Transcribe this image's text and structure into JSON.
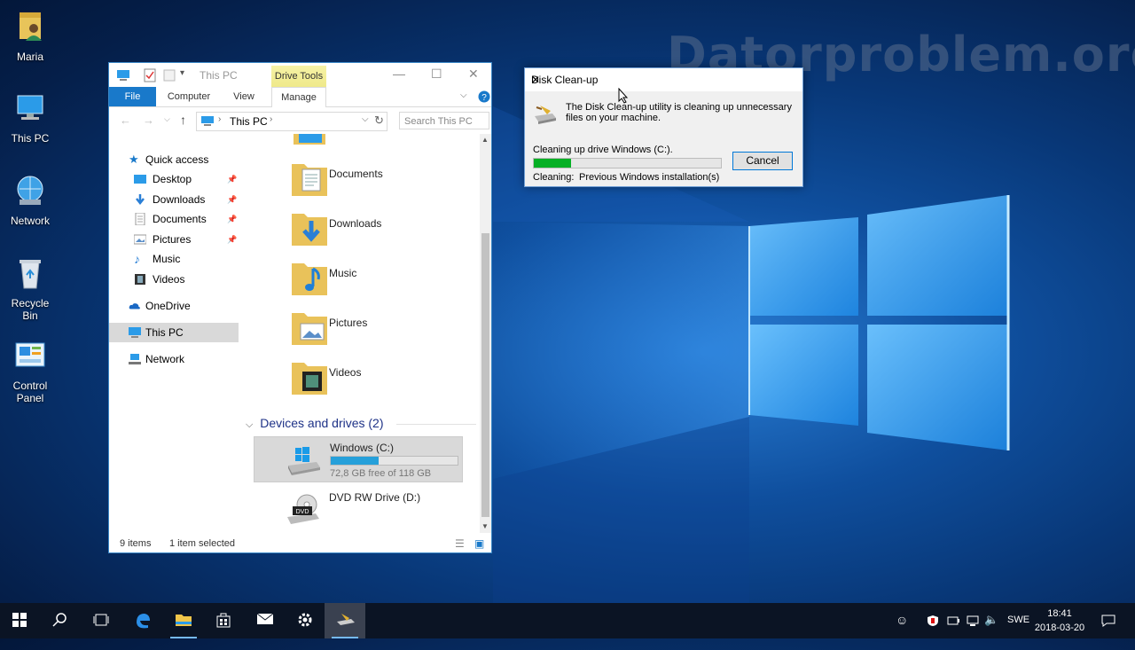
{
  "watermark": "Datorproblem.org",
  "desktop_icons": [
    {
      "label": "Maria"
    },
    {
      "label": "This PC"
    },
    {
      "label": "Network"
    },
    {
      "label": "Recycle Bin"
    },
    {
      "label": "Control\nPanel"
    }
  ],
  "explorer": {
    "title": "This PC",
    "drive_tools_tab": "Drive Tools",
    "ribbon_tabs": [
      "File",
      "Computer",
      "View",
      "Manage"
    ],
    "address_path": "This PC",
    "search_placeholder": "Search This PC",
    "nav": {
      "quick_access": "Quick access",
      "items": [
        "Desktop",
        "Downloads",
        "Documents",
        "Pictures",
        "Music",
        "Videos"
      ],
      "onedrive": "OneDrive",
      "this_pc": "This PC",
      "network": "Network"
    },
    "folders": [
      "Documents",
      "Downloads",
      "Music",
      "Pictures",
      "Videos"
    ],
    "devices_header": "Devices and drives (2)",
    "drives": [
      {
        "name": "Windows (C:)",
        "free_text": "72,8 GB free of 118 GB",
        "used_fraction": 0.38
      },
      {
        "name": "DVD RW Drive (D:)",
        "dvd_label": "DVD"
      }
    ],
    "status_items": "9 items",
    "status_selected": "1 item selected"
  },
  "dialog": {
    "title": "Disk Clean-up",
    "message": "The Disk Clean-up utility is cleaning up unnecessary files on your machine.",
    "progress_label": "Cleaning up drive Windows (C:).",
    "progress_fraction": 0.2,
    "cancel_label": "Cancel",
    "cleaning_label": "Cleaning:",
    "cleaning_value": "Previous Windows installation(s)"
  },
  "taskbar": {
    "language": "SWE",
    "time": "18:41",
    "date": "2018-03-20"
  },
  "colors": {
    "accent": "#1979ca",
    "progress_green": "#06b025",
    "drive_bar": "#26a0da"
  }
}
